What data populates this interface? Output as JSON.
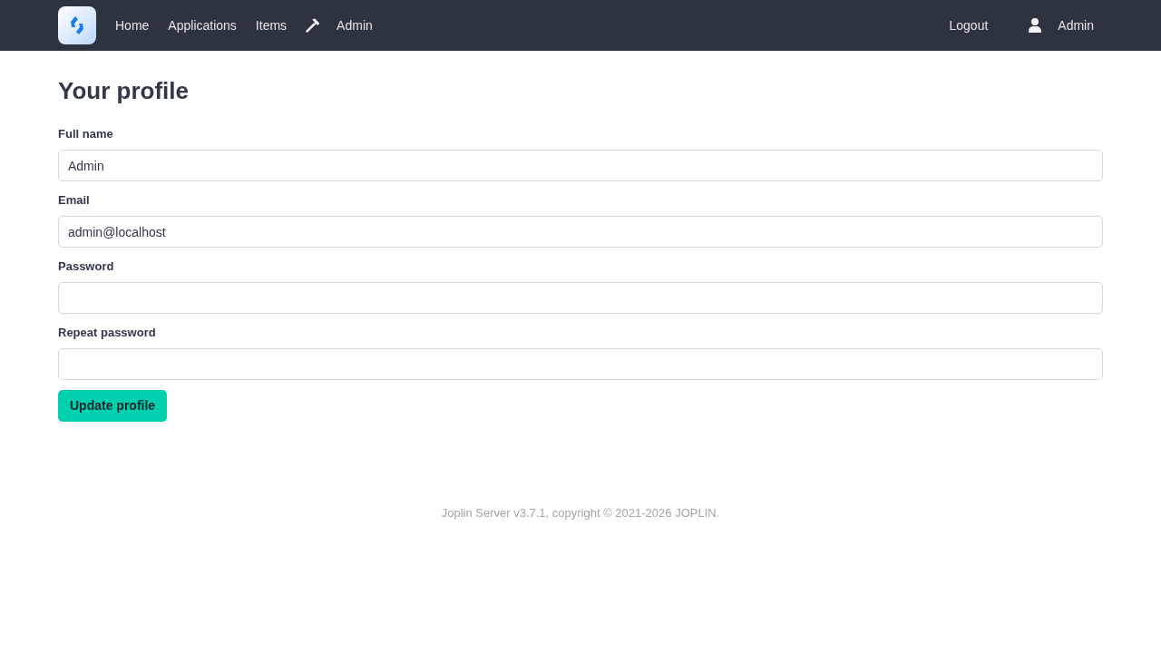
{
  "navbar": {
    "left_links": [
      {
        "label": "Home",
        "kind": "link"
      },
      {
        "label": "Applications",
        "kind": "link"
      },
      {
        "label": "Items",
        "kind": "link"
      },
      {
        "label": "Admin",
        "kind": "tools"
      }
    ],
    "right_links": [
      {
        "label": "Logout",
        "kind": "link"
      },
      {
        "label": "Admin",
        "kind": "account"
      }
    ]
  },
  "form": {
    "title": "Your profile",
    "fields": [
      {
        "label": "Full name",
        "value": "Admin"
      },
      {
        "label": "Email",
        "value": "admin@localhost"
      },
      {
        "label": "Password"
      },
      {
        "label": "Repeat password"
      }
    ],
    "submit": "Update profile"
  },
  "footer": "Joplin Server v3.7.1, copyright © 2021-2026 JOPLIN."
}
